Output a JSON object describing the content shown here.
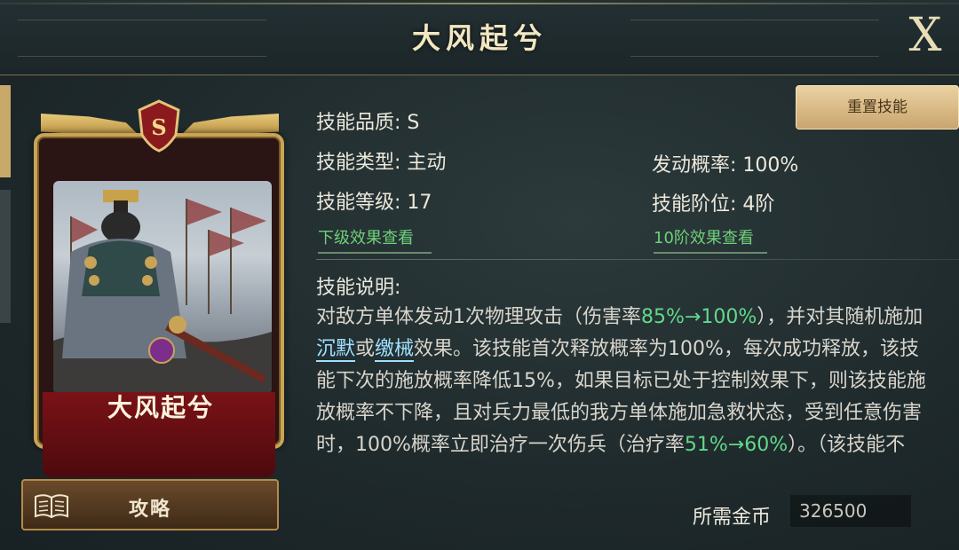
{
  "header": {
    "title": "大风起兮",
    "close_label": "X"
  },
  "card": {
    "name": "大风起兮",
    "grade_letter": "S"
  },
  "guide_button": {
    "label": "攻略"
  },
  "reset_button": {
    "label": "重置技能"
  },
  "stats": {
    "quality": "技能品质: S",
    "type": "技能类型: 主动",
    "trigger_rate": "发动概率: 100%",
    "level": "技能等级: 17",
    "tier": "技能阶位: 4阶",
    "lower_effect_link": "下级效果查看",
    "tier10_effect_link": "10阶效果查看"
  },
  "description": {
    "title": "技能说明:",
    "p1": "对敌方单体发动1次物理攻击（伤害率",
    "p1_hl": "85%→100%",
    "p2": "），并对其随机施加",
    "kw1": "沉默",
    "p3": "或",
    "kw2": "缴械",
    "p4": "效果。该技能首次释放概率为100%，每次成功释放，该技能下次的施放概率降低15%，如果目标已处于控制效果下，则该技能施放概率不下降，且对兵力最低的我方单体施加急救状态，受到任意伤害时，100%概率立即治疗一次伤兵（治疗率",
    "p4_hl": "51%→60%",
    "p5": "）。（该技能不"
  },
  "cost": {
    "label": "所需金币",
    "value": "326500"
  },
  "colors": {
    "accent_gold": "#c9a457",
    "highlight_green": "#62d98a",
    "link_green": "#6fcf7a",
    "keyword_blue": "#9fe0ff"
  }
}
